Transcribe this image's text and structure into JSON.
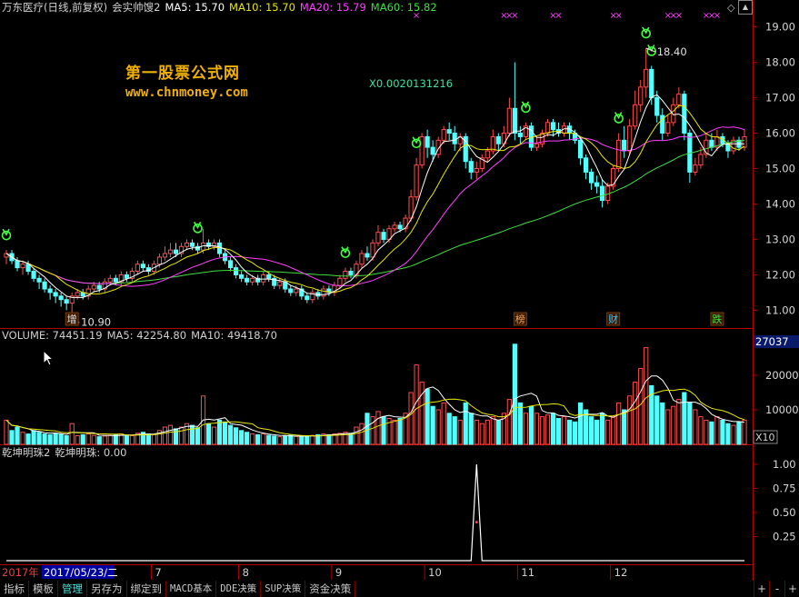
{
  "header": {
    "stock": "万东医疗(日线,前复权)",
    "indicator": "会实帅馊2",
    "ma5": "MA5: 15.70",
    "ma10": "MA10: 15.70",
    "ma20": "MA20: 15.79",
    "ma60": "MA60: 15.82"
  },
  "watermark": {
    "title": "第一股票公式网",
    "url": "www.chnmoney.com"
  },
  "price_panel": {
    "y_ticks": [
      "19.00",
      "18.00",
      "17.00",
      "16.00",
      "15.00",
      "14.00",
      "13.00",
      "12.00",
      "11.00"
    ],
    "high_label": "18.40",
    "low_label": "10.90",
    "x_label": "X0.0020131216",
    "event_tags": [
      {
        "text": "增",
        "color": "#e0e0e0"
      },
      {
        "text": "榜",
        "color": "#f0a050"
      },
      {
        "text": "财",
        "color": "#40c0ff"
      },
      {
        "text": "跌",
        "color": "#40e040"
      }
    ],
    "corner_icon": "diamond-icon"
  },
  "volume_panel": {
    "header": {
      "volume": "VOLUME: 74451.19",
      "ma5": "MA5: 42254.80",
      "ma10": "MA10: 49418.70"
    },
    "y_ticks": [
      "20000",
      "10000"
    ],
    "top_value": "27037",
    "unit": "X10"
  },
  "qk_panel": {
    "header": {
      "name": "乾坤明珠2",
      "value": "乾坤明珠: 0.00"
    },
    "y_ticks": [
      "1.00",
      "0.75",
      "0.50",
      "0.25"
    ]
  },
  "date_axis": {
    "year": "2017年",
    "cursor_date": "2017/05/23/二",
    "months": [
      "7",
      "8",
      "9",
      "10",
      "11",
      "12"
    ]
  },
  "bottom_tabs": [
    "指标",
    "模板",
    "管理",
    "另存为",
    "绑定到",
    "MACD基本",
    "DDE决策",
    "SUP决策",
    "资金决策"
  ],
  "nav_buttons": [
    "+",
    "-",
    "+"
  ],
  "colors": {
    "up": "#ff4d4d",
    "down": "#54ffff",
    "ma5": "#ffffff",
    "ma10": "#e8e800",
    "ma20": "#ff40ff",
    "ma60": "#40e040",
    "axis": "#b00000",
    "signal": "#40ff40"
  },
  "chart_data": {
    "type": "candlestick",
    "price_range": [
      10.6,
      19.4
    ],
    "candles": [
      [
        12.5,
        12.6,
        12.7,
        12.3
      ],
      [
        12.6,
        12.4,
        12.7,
        12.3
      ],
      [
        12.4,
        12.2,
        12.5,
        12.1
      ],
      [
        12.2,
        12.3,
        12.4,
        12.0
      ],
      [
        12.3,
        12.1,
        12.4,
        12.0
      ],
      [
        12.1,
        11.9,
        12.2,
        11.8
      ],
      [
        11.9,
        11.8,
        12.0,
        11.6
      ],
      [
        11.8,
        11.6,
        11.9,
        11.5
      ],
      [
        11.6,
        11.5,
        11.7,
        11.3
      ],
      [
        11.5,
        11.4,
        11.6,
        11.2
      ],
      [
        11.4,
        11.3,
        11.5,
        11.1
      ],
      [
        11.3,
        11.2,
        11.4,
        11.0
      ],
      [
        11.2,
        11.4,
        11.5,
        10.9
      ],
      [
        11.4,
        11.5,
        11.6,
        11.3
      ],
      [
        11.5,
        11.4,
        11.6,
        11.3
      ],
      [
        11.4,
        11.6,
        11.7,
        11.3
      ],
      [
        11.6,
        11.7,
        11.8,
        11.5
      ],
      [
        11.7,
        11.6,
        11.8,
        11.5
      ],
      [
        11.6,
        11.8,
        11.9,
        11.5
      ],
      [
        11.8,
        11.9,
        12.0,
        11.7
      ],
      [
        11.9,
        11.8,
        12.0,
        11.7
      ],
      [
        11.8,
        12.0,
        12.1,
        11.7
      ],
      [
        12.0,
        11.9,
        12.1,
        11.8
      ],
      [
        11.9,
        12.1,
        12.2,
        11.8
      ],
      [
        12.1,
        12.3,
        12.4,
        12.0
      ],
      [
        12.3,
        12.2,
        12.4,
        12.1
      ],
      [
        12.2,
        12.1,
        12.3,
        12.0
      ],
      [
        12.1,
        12.3,
        12.4,
        12.0
      ],
      [
        12.3,
        12.5,
        12.6,
        12.2
      ],
      [
        12.5,
        12.6,
        12.8,
        12.4
      ],
      [
        12.6,
        12.7,
        12.9,
        12.5
      ],
      [
        12.7,
        12.6,
        12.9,
        12.5
      ],
      [
        12.6,
        12.8,
        12.9,
        12.5
      ],
      [
        12.8,
        12.9,
        13.0,
        12.7
      ],
      [
        12.9,
        12.8,
        13.0,
        12.7
      ],
      [
        12.8,
        12.7,
        12.9,
        12.6
      ],
      [
        12.7,
        12.9,
        13.3,
        12.6
      ],
      [
        12.9,
        12.8,
        13.0,
        12.7
      ],
      [
        12.8,
        12.9,
        13.0,
        12.7
      ],
      [
        12.9,
        12.6,
        13.0,
        12.5
      ],
      [
        12.6,
        12.4,
        12.7,
        12.3
      ],
      [
        12.4,
        12.2,
        12.5,
        12.1
      ],
      [
        12.2,
        12.0,
        12.3,
        11.9
      ],
      [
        12.0,
        11.9,
        12.1,
        11.8
      ],
      [
        11.9,
        11.8,
        12.0,
        11.7
      ],
      [
        11.8,
        11.9,
        12.0,
        11.7
      ],
      [
        11.9,
        11.8,
        12.0,
        11.7
      ],
      [
        11.8,
        12.0,
        12.1,
        11.7
      ],
      [
        12.0,
        11.9,
        12.1,
        11.8
      ],
      [
        11.9,
        11.7,
        12.0,
        11.6
      ],
      [
        11.7,
        11.8,
        11.9,
        11.6
      ],
      [
        11.8,
        11.6,
        11.9,
        11.5
      ],
      [
        11.6,
        11.5,
        11.7,
        11.4
      ],
      [
        11.5,
        11.6,
        11.7,
        11.4
      ],
      [
        11.6,
        11.4,
        11.7,
        11.3
      ],
      [
        11.4,
        11.3,
        11.5,
        11.2
      ],
      [
        11.3,
        11.5,
        11.6,
        11.2
      ],
      [
        11.5,
        11.4,
        11.6,
        11.3
      ],
      [
        11.4,
        11.6,
        11.7,
        11.3
      ],
      [
        11.6,
        11.5,
        11.7,
        11.4
      ],
      [
        11.5,
        11.7,
        11.8,
        11.4
      ],
      [
        11.7,
        11.9,
        12.0,
        11.6
      ],
      [
        11.9,
        12.1,
        12.2,
        11.8
      ],
      [
        12.1,
        12.0,
        12.2,
        11.9
      ],
      [
        12.0,
        12.3,
        12.4,
        11.9
      ],
      [
        12.3,
        12.6,
        12.7,
        12.2
      ],
      [
        12.6,
        12.5,
        12.8,
        12.4
      ],
      [
        12.5,
        12.9,
        13.0,
        12.4
      ],
      [
        12.9,
        13.2,
        13.4,
        12.8
      ],
      [
        13.2,
        13.0,
        13.3,
        12.9
      ],
      [
        13.0,
        13.3,
        13.4,
        12.9
      ],
      [
        13.3,
        13.4,
        13.5,
        13.2
      ],
      [
        13.4,
        13.3,
        13.5,
        13.2
      ],
      [
        13.3,
        13.6,
        13.7,
        13.2
      ],
      [
        13.6,
        14.2,
        14.4,
        13.5
      ],
      [
        14.2,
        15.1,
        15.3,
        14.1
      ],
      [
        15.1,
        15.9,
        16.0,
        15.0
      ],
      [
        15.9,
        15.6,
        16.1,
        15.3
      ],
      [
        15.6,
        15.4,
        15.8,
        15.2
      ],
      [
        15.4,
        15.8,
        15.9,
        15.3
      ],
      [
        15.8,
        16.1,
        16.2,
        15.7
      ],
      [
        16.1,
        16.0,
        16.3,
        15.8
      ],
      [
        16.0,
        15.7,
        16.2,
        15.5
      ],
      [
        15.7,
        15.9,
        16.0,
        15.5
      ],
      [
        15.9,
        15.2,
        16.0,
        15.0
      ],
      [
        15.2,
        14.9,
        15.3,
        14.7
      ],
      [
        14.9,
        15.0,
        15.2,
        14.7
      ],
      [
        15.0,
        15.3,
        15.4,
        14.9
      ],
      [
        15.3,
        15.5,
        15.6,
        15.2
      ],
      [
        15.5,
        15.9,
        16.1,
        15.4
      ],
      [
        15.9,
        15.7,
        16.0,
        15.5
      ],
      [
        15.7,
        16.0,
        16.2,
        15.6
      ],
      [
        16.0,
        16.7,
        17.0,
        15.9
      ],
      [
        16.7,
        16.0,
        18.0,
        15.8
      ],
      [
        16.0,
        15.9,
        16.2,
        15.7
      ],
      [
        15.9,
        16.2,
        16.3,
        15.8
      ],
      [
        16.2,
        15.6,
        16.3,
        15.5
      ],
      [
        15.6,
        15.7,
        15.9,
        15.5
      ],
      [
        15.7,
        16.0,
        16.1,
        15.6
      ],
      [
        16.0,
        16.3,
        16.4,
        15.9
      ],
      [
        16.3,
        16.1,
        16.4,
        15.9
      ],
      [
        16.1,
        16.0,
        16.3,
        15.9
      ],
      [
        16.0,
        16.2,
        16.3,
        15.9
      ],
      [
        16.2,
        16.0,
        16.3,
        15.8
      ],
      [
        16.0,
        15.8,
        16.1,
        15.7
      ],
      [
        15.8,
        15.3,
        15.9,
        15.1
      ],
      [
        15.3,
        14.9,
        15.4,
        14.7
      ],
      [
        14.9,
        14.6,
        15.0,
        14.4
      ],
      [
        14.6,
        14.5,
        14.8,
        14.3
      ],
      [
        14.5,
        14.1,
        14.7,
        13.9
      ],
      [
        14.1,
        14.5,
        14.6,
        14.0
      ],
      [
        14.5,
        15.0,
        15.1,
        14.4
      ],
      [
        15.0,
        15.8,
        16.0,
        14.9
      ],
      [
        15.8,
        15.5,
        16.2,
        15.3
      ],
      [
        15.5,
        16.2,
        16.4,
        15.4
      ],
      [
        16.2,
        16.8,
        17.2,
        16.1
      ],
      [
        16.8,
        17.3,
        17.5,
        16.6
      ],
      [
        17.3,
        17.8,
        18.4,
        17.0
      ],
      [
        17.8,
        17.0,
        17.9,
        16.8
      ],
      [
        17.0,
        16.5,
        17.2,
        16.3
      ],
      [
        16.5,
        16.0,
        16.7,
        15.8
      ],
      [
        16.0,
        16.3,
        16.5,
        15.9
      ],
      [
        16.3,
        16.8,
        17.0,
        16.2
      ],
      [
        16.8,
        17.1,
        17.3,
        16.7
      ],
      [
        17.1,
        16.0,
        17.2,
        15.8
      ],
      [
        16.0,
        14.9,
        16.1,
        14.6
      ],
      [
        14.9,
        15.1,
        15.3,
        14.8
      ],
      [
        15.1,
        15.4,
        15.6,
        15.0
      ],
      [
        15.4,
        15.8,
        16.0,
        15.3
      ],
      [
        15.8,
        15.6,
        16.0,
        15.5
      ],
      [
        15.6,
        15.9,
        16.1,
        15.5
      ],
      [
        15.9,
        15.7,
        16.0,
        15.6
      ],
      [
        15.7,
        15.5,
        15.8,
        15.3
      ],
      [
        15.5,
        15.8,
        15.9,
        15.4
      ],
      [
        15.8,
        15.6,
        15.9,
        15.5
      ],
      [
        15.6,
        15.9,
        16.1,
        15.5
      ]
    ],
    "volume": [
      7000,
      4000,
      5000,
      3500,
      3000,
      4000,
      3500,
      3000,
      2800,
      3200,
      3000,
      2500,
      6000,
      2500,
      2800,
      3000,
      2600,
      2200,
      2400,
      2600,
      2800,
      3000,
      2700,
      2500,
      3200,
      3500,
      3000,
      2800,
      4000,
      5000,
      5500,
      4500,
      5000,
      6000,
      5500,
      4800,
      14000,
      6000,
      5000,
      7000,
      6500,
      5500,
      4800,
      4000,
      3500,
      3000,
      2800,
      3000,
      2600,
      2400,
      2200,
      2500,
      2600,
      2300,
      2200,
      2400,
      2600,
      2800,
      3000,
      2800,
      3000,
      3200,
      3500,
      3200,
      5000,
      6000,
      9000,
      8000,
      9500,
      8000,
      7500,
      7000,
      7500,
      9000,
      15000,
      23000,
      18000,
      16000,
      11000,
      10000,
      12000,
      9000,
      8000,
      7000,
      12000,
      9000,
      7000,
      6000,
      7000,
      8000,
      7000,
      9000,
      13000,
      29000,
      12000,
      9000,
      11000,
      9000,
      8000,
      8500,
      9000,
      7500,
      8000,
      7000,
      6500,
      12000,
      10000,
      8000,
      7000,
      9000,
      7000,
      8000,
      12000,
      10000,
      14000,
      18000,
      22000,
      28000,
      17000,
      14000,
      12000,
      10000,
      11000,
      13000,
      15000,
      12000,
      10000,
      8000,
      7000,
      6500,
      8000,
      7000,
      6000,
      5500,
      6500,
      7000
    ],
    "qk_signal": {
      "index": 86,
      "value": 1.0
    },
    "signal_arrows": [
      0,
      35,
      62,
      75,
      95,
      112,
      117,
      118
    ],
    "ma": {
      "ma5": "computed",
      "ma10": "computed",
      "ma20": "computed",
      "ma60": "computed"
    }
  }
}
